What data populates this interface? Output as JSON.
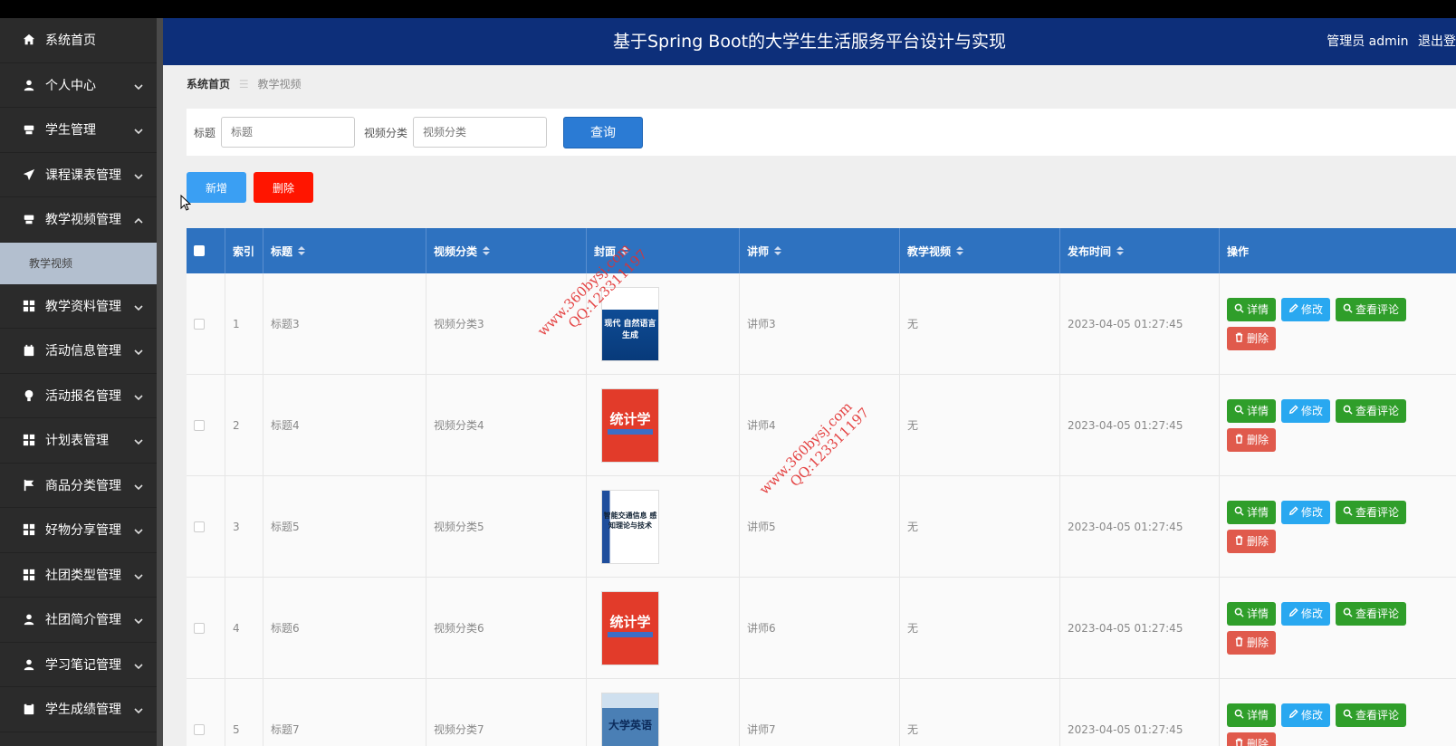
{
  "sidebar": {
    "items": [
      {
        "label": "系统首页",
        "icon": "home-icon",
        "has_chevron": false
      },
      {
        "label": "个人中心",
        "icon": "user-icon",
        "has_chevron": true
      },
      {
        "label": "学生管理",
        "icon": "desk-icon",
        "has_chevron": true
      },
      {
        "label": "课程课表管理",
        "icon": "send-icon",
        "has_chevron": true
      },
      {
        "label": "教学视频管理",
        "icon": "desk-icon",
        "has_chevron": true,
        "expanded": true
      },
      {
        "label": "教学资料管理",
        "icon": "grid-icon",
        "has_chevron": true
      },
      {
        "label": "活动信息管理",
        "icon": "calendar-icon",
        "has_chevron": true
      },
      {
        "label": "活动报名管理",
        "icon": "bulb-icon",
        "has_chevron": true
      },
      {
        "label": "计划表管理",
        "icon": "grid-icon",
        "has_chevron": true
      },
      {
        "label": "商品分类管理",
        "icon": "flag-icon",
        "has_chevron": true
      },
      {
        "label": "好物分享管理",
        "icon": "grid-icon",
        "has_chevron": true
      },
      {
        "label": "社团类型管理",
        "icon": "grid-icon",
        "has_chevron": true
      },
      {
        "label": "社团简介管理",
        "icon": "user-icon",
        "has_chevron": true
      },
      {
        "label": "学习笔记管理",
        "icon": "user-icon",
        "has_chevron": true
      },
      {
        "label": "学生成绩管理",
        "icon": "clipboard-icon",
        "has_chevron": true
      }
    ],
    "sub_item": "教学视频"
  },
  "header": {
    "title": "基于Spring Boot的大学生生活服务平台设计与实现",
    "user": "管理员 admin",
    "logout": "退出登"
  },
  "breadcrumb": {
    "home": "系统首页",
    "sep": "☰",
    "current": "教学视频"
  },
  "search": {
    "title_label": "标题",
    "title_placeholder": "标题",
    "category_label": "视频分类",
    "category_placeholder": "视频分类",
    "query_button": "查询"
  },
  "toolbar": {
    "add": "新增",
    "delete": "删除"
  },
  "table": {
    "headers": [
      "索引",
      "标题",
      "视频分类",
      "封面",
      "讲师",
      "教学视频",
      "发布时间",
      "操作"
    ],
    "rows": [
      {
        "index": "1",
        "title": "标题3",
        "category": "视频分类3",
        "cover": "cover-a",
        "cover_text": "现代 自然语言生成",
        "teacher": "讲师3",
        "video": "无",
        "time": "2023-04-05 01:27:45"
      },
      {
        "index": "2",
        "title": "标题4",
        "category": "视频分类4",
        "cover": "cover-b",
        "cover_text": "统计学",
        "teacher": "讲师4",
        "video": "无",
        "time": "2023-04-05 01:27:45"
      },
      {
        "index": "3",
        "title": "标题5",
        "category": "视频分类5",
        "cover": "cover-c",
        "cover_text": "智能交通信息 感知理论与技术",
        "teacher": "讲师5",
        "video": "无",
        "time": "2023-04-05 01:27:45"
      },
      {
        "index": "4",
        "title": "标题6",
        "category": "视频分类6",
        "cover": "cover-b",
        "cover_text": "统计学",
        "teacher": "讲师6",
        "video": "无",
        "time": "2023-04-05 01:27:45"
      },
      {
        "index": "5",
        "title": "标题7",
        "category": "视频分类7",
        "cover": "cover-d",
        "cover_text": "大学英语",
        "teacher": "讲师7",
        "video": "无",
        "time": "2023-04-05 01:27:45"
      }
    ],
    "actions": {
      "detail": "详情",
      "edit": "修改",
      "comments": "查看评论",
      "delete": "删除"
    }
  },
  "watermarks": [
    {
      "line1": "www.360bysj.com",
      "line2": "QQ:123311197"
    },
    {
      "line1": "www.360bysj.com",
      "line2": "QQ:123311197"
    }
  ],
  "colors": {
    "header": "#0d2f7a",
    "sidebar": "#2b2b2b",
    "table_head": "#2e72c0",
    "green": "#2f9e2a",
    "blue": "#29a8f0",
    "red": "#e05a4c"
  }
}
